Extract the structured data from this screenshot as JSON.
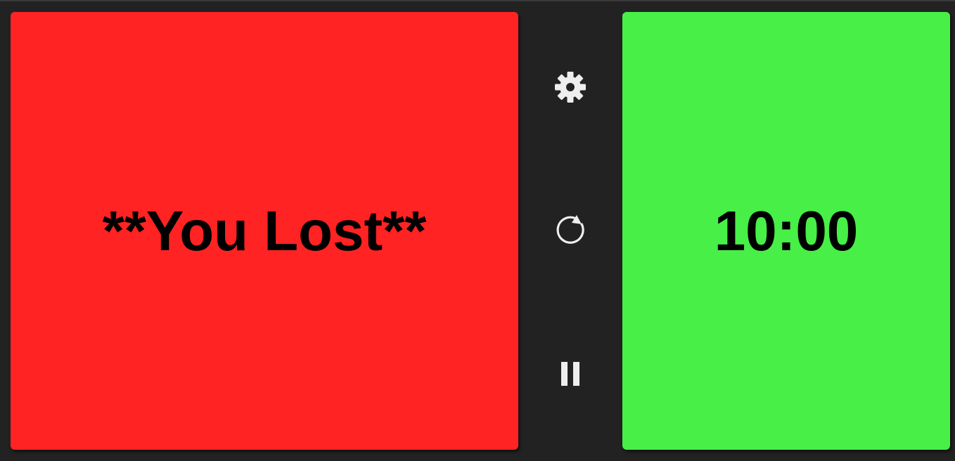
{
  "players": {
    "left": {
      "display": "**You Lost**",
      "color": "#ff2323"
    },
    "right": {
      "display": "10:00",
      "color": "#47ef47"
    }
  },
  "controls": {
    "settings": {
      "icon": "gear-icon"
    },
    "reset": {
      "icon": "refresh-icon"
    },
    "pause": {
      "icon": "pause-icon"
    }
  },
  "theme": {
    "background": "#222222",
    "icon_color": "#eeeeee"
  }
}
